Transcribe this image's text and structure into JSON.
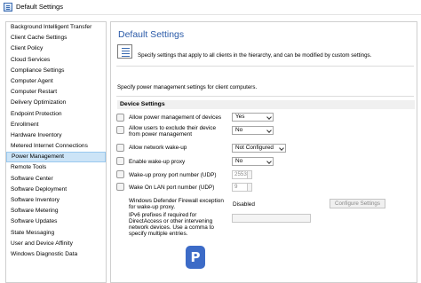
{
  "window": {
    "title": "Default Settings"
  },
  "sidebar": {
    "items": [
      {
        "label": "Background Intelligent Transfer"
      },
      {
        "label": "Client Cache Settings"
      },
      {
        "label": "Client Policy"
      },
      {
        "label": "Cloud Services"
      },
      {
        "label": "Compliance Settings"
      },
      {
        "label": "Computer Agent"
      },
      {
        "label": "Computer Restart"
      },
      {
        "label": "Delivery Optimization"
      },
      {
        "label": "Endpoint Protection"
      },
      {
        "label": "Enrollment"
      },
      {
        "label": "Hardware Inventory"
      },
      {
        "label": "Metered Internet Connections"
      },
      {
        "label": "Power Management",
        "selected": true
      },
      {
        "label": "Remote Tools"
      },
      {
        "label": "Software Center"
      },
      {
        "label": "Software Deployment"
      },
      {
        "label": "Software Inventory"
      },
      {
        "label": "Software Metering"
      },
      {
        "label": "Software Updates"
      },
      {
        "label": "State Messaging"
      },
      {
        "label": "User and Device Affinity"
      },
      {
        "label": "Windows Diagnostic Data"
      }
    ]
  },
  "main": {
    "title": "Default Settings",
    "description": "Specify settings that apply to all clients in the hierarchy, and can be modified by custom settings.",
    "intro": "Specify power management settings for client computers.",
    "group_title": "Device Settings",
    "settings": {
      "allow_power_mgmt": {
        "label": "Allow power management of devices",
        "value": "Yes"
      },
      "allow_exclude_line1": "Allow users to exclude their device",
      "allow_exclude_line2": "from power management",
      "allow_exclude_value": "No",
      "allow_wakeup": {
        "label": "Allow network wake-up",
        "value": "Not Configured"
      },
      "enable_proxy": {
        "label": "Enable wake-up proxy",
        "value": "No"
      },
      "proxy_port": {
        "label": "Wake-up proxy port number (UDP)",
        "value": "25536"
      },
      "wol_port": {
        "label": "Wake On LAN port number (UDP)",
        "value": "9"
      },
      "firewall_line1": "Windows Defender Firewall exception",
      "firewall_line2": "for wake-up proxy.",
      "firewall_value": "Disabled",
      "configure_button": "Configure Settings",
      "ipv6_line1": "IPv6 prefixes if required for",
      "ipv6_line2": "DirectAccess or other intervening",
      "ipv6_line3": "network devices. Use a comma to",
      "ipv6_line4": "specify multiple entries."
    }
  },
  "logo": {
    "letter": "P",
    "color": "#3c6bc7"
  },
  "colors": {
    "title_blue": "#2a5aa8",
    "selection": "#cce4f7"
  }
}
